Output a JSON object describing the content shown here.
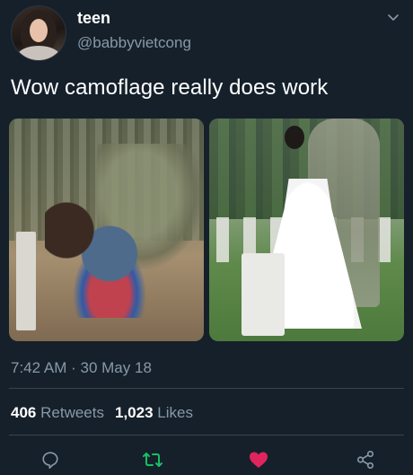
{
  "author": {
    "display_name": "teen",
    "handle": "@babbyvietcong"
  },
  "tweet": {
    "text": "Wow camoflage really does work",
    "time": "7:42 AM",
    "separator": "·",
    "date": "30 May 18"
  },
  "stats": {
    "retweets_count": "406",
    "retweets_label": "Retweets",
    "likes_count": "1,023",
    "likes_label": "Likes"
  },
  "actions": {
    "reply_icon": "reply-icon",
    "retweet_icon": "retweet-icon",
    "like_icon": "heart-icon",
    "share_icon": "share-icon"
  },
  "colors": {
    "background": "#15202b",
    "secondary_text": "#8899a6",
    "retweet_green": "#17bf63",
    "like_pink": "#e0245e"
  }
}
